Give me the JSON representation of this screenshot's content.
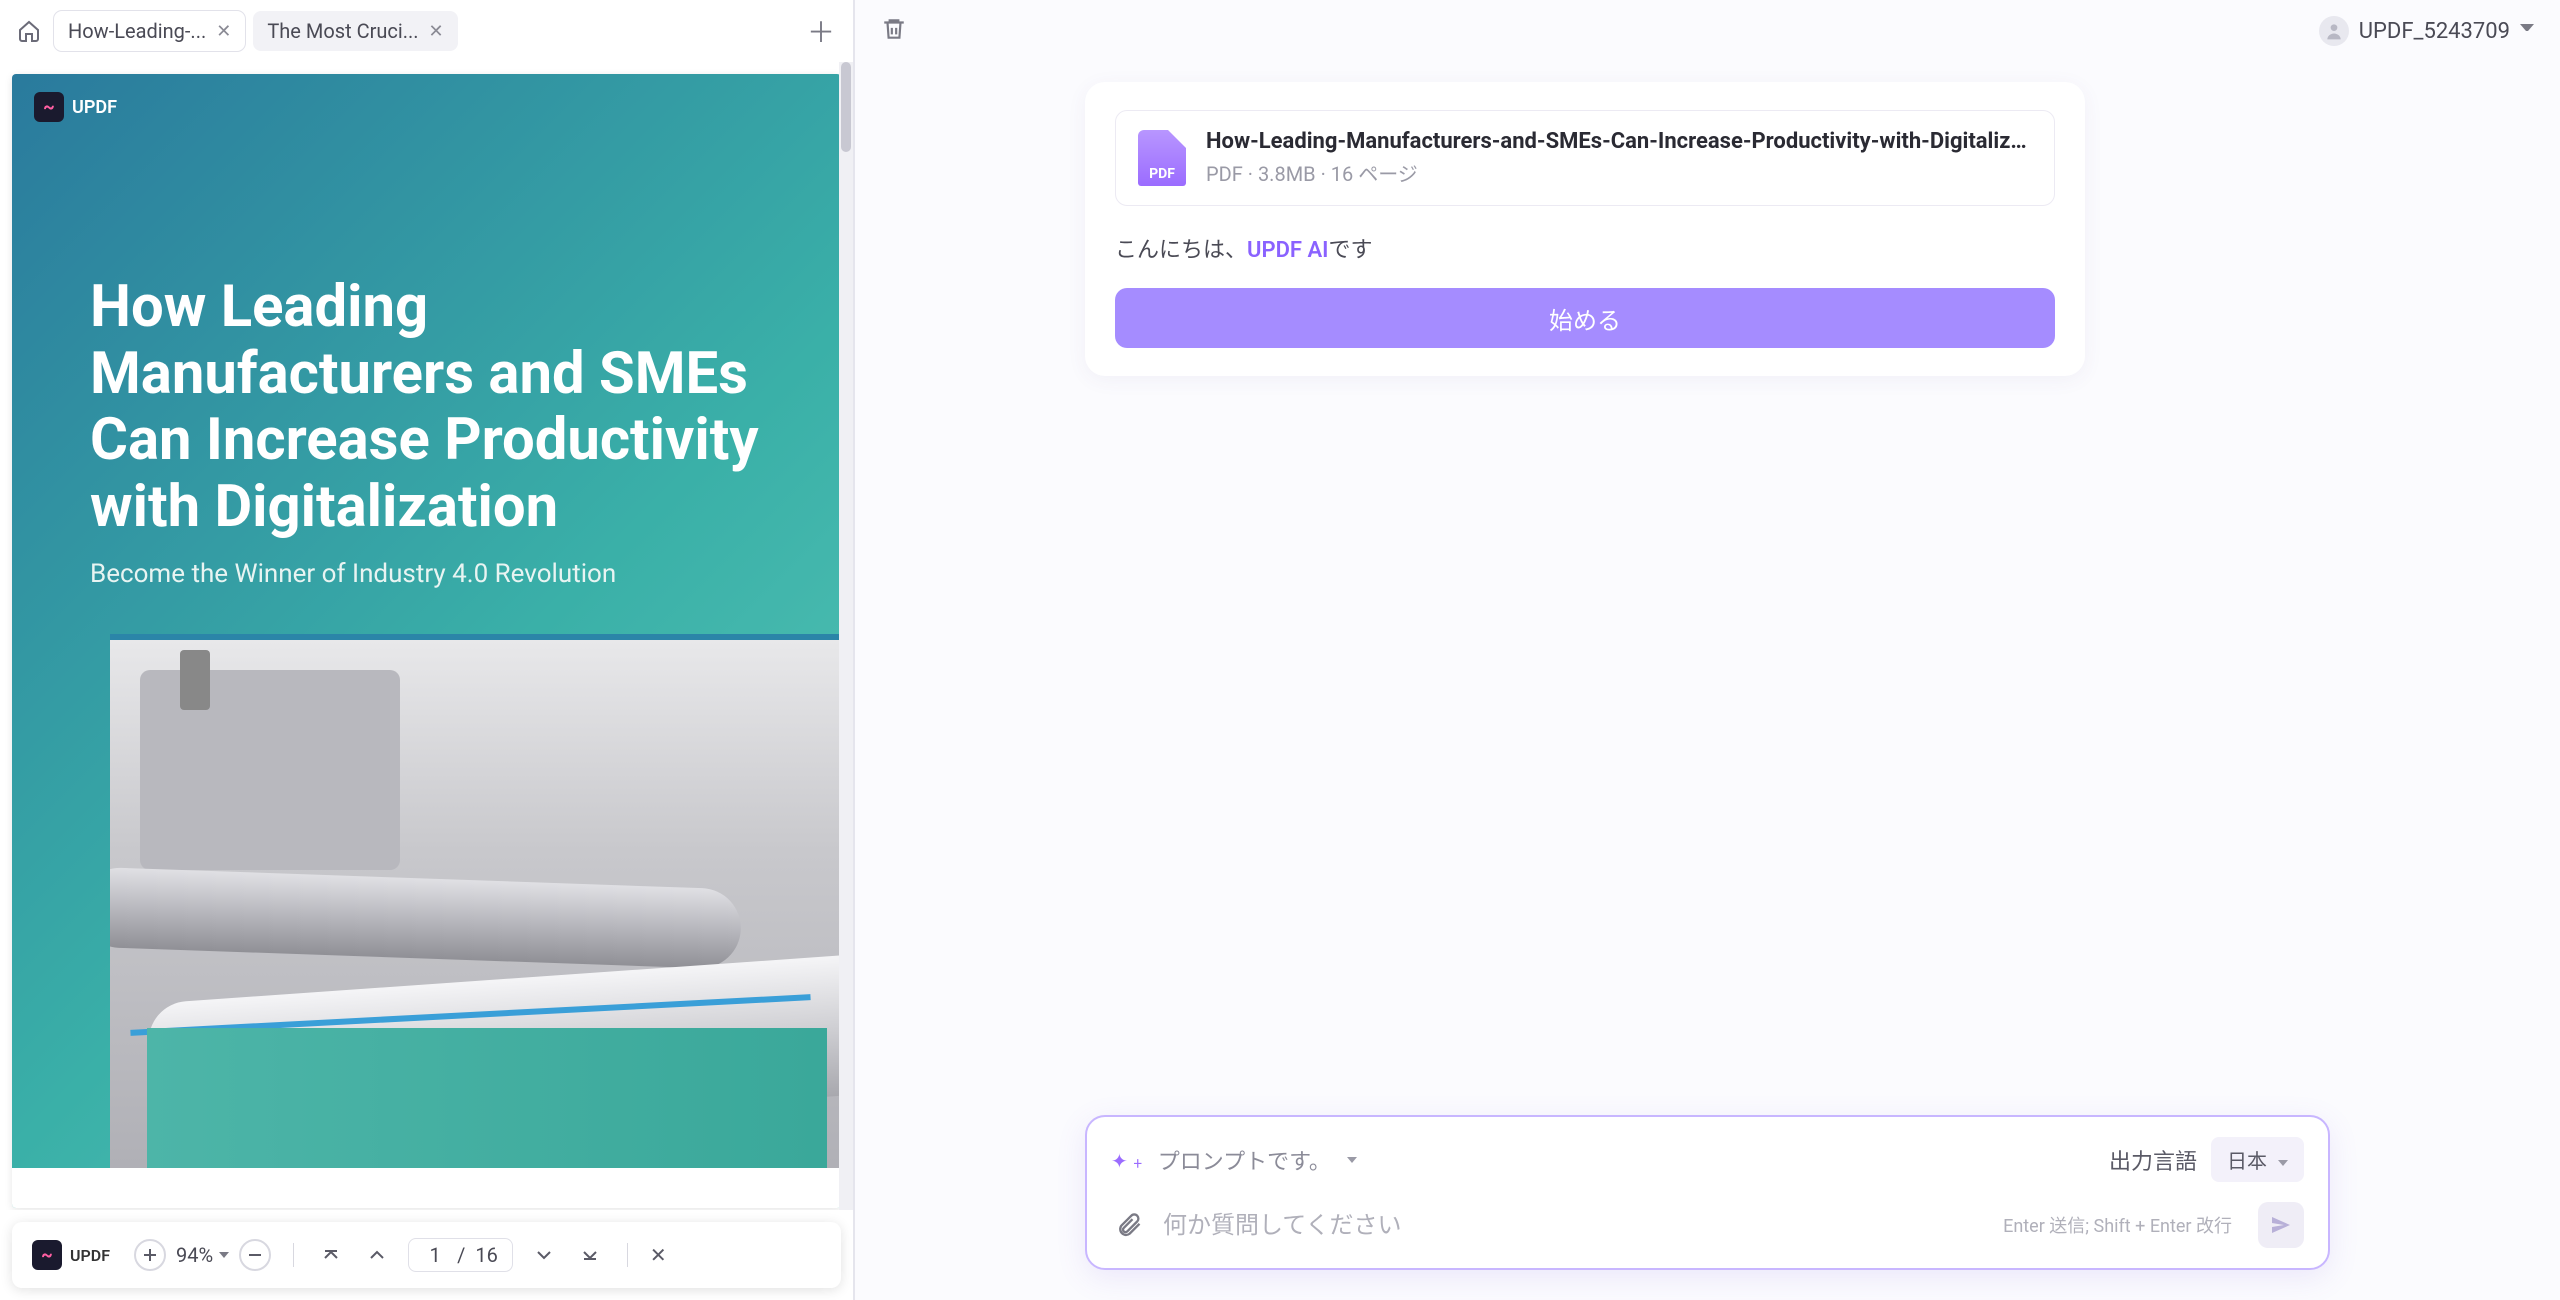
{
  "tabs": {
    "home_tooltip": "Home",
    "items": [
      {
        "label": "How-Leading-...",
        "active": true
      },
      {
        "label": "The Most Cruci...",
        "active": false
      }
    ]
  },
  "document": {
    "brand": "UPDF",
    "title": "How Leading Manufacturers and SMEs Can Increase Productivity with Digitalization",
    "subtitle": "Become the Winner of Industry 4.0 Revolution"
  },
  "viewer_bar": {
    "brand": "UPDF",
    "zoom": "94%",
    "page_current": "1",
    "page_sep": "/",
    "page_total": "16"
  },
  "user": {
    "name": "UPDF_5243709"
  },
  "chat": {
    "file": {
      "icon_label": "PDF",
      "name": "How-Leading-Manufacturers-and-SMEs-Can-Increase-Productivity-with-Digitalization.pdf",
      "meta": "PDF · 3.8MB · 16 ページ"
    },
    "greeting_prefix": "こんにちは、",
    "greeting_brand": "UPDF AI",
    "greeting_suffix": "です",
    "start_button": "始める"
  },
  "input": {
    "prompt_label": "プロンプトです。",
    "output_lang_label": "出力言語",
    "output_lang_value": "日本",
    "placeholder": "何か質問してください",
    "send_hint": "Enter 送信; Shift + Enter 改行"
  }
}
